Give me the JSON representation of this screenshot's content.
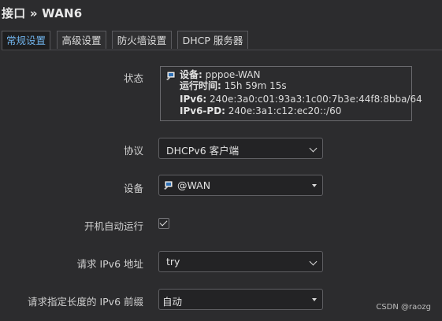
{
  "page": {
    "title": "接口 » WAN6"
  },
  "tabs": [
    {
      "label": "常规设置",
      "active": true
    },
    {
      "label": "高级设置",
      "active": false
    },
    {
      "label": "防火墙设置",
      "active": false
    },
    {
      "label": "DHCP 服务器",
      "active": false
    }
  ],
  "status": {
    "label": "状态",
    "device_key": "设备:",
    "device_val": " pppoe-WAN",
    "uptime_key": "运行时间:",
    "uptime_val": " 15h 59m 15s",
    "ipv6_key": "IPv6:",
    "ipv6_val": " 240e:3a0:c01:93a3:1c00:7b3e:44f8:8bba/64",
    "ipv6pd_key": "IPv6-PD:",
    "ipv6pd_val": " 240e:3a1:c12:ec20::/60"
  },
  "protocol": {
    "label": "协议",
    "value": "DHCPv6 客户端"
  },
  "device": {
    "label": "设备",
    "value": "@WAN"
  },
  "autostart": {
    "label": "开机自动运行",
    "checked": true
  },
  "req_addr": {
    "label": "请求 IPv6 地址",
    "value": "try"
  },
  "req_prefix": {
    "label": "请求指定长度的 IPv6 前缀",
    "value": "自动"
  },
  "watermark": "CSDN @raozg",
  "colors": {
    "active_tab": "#6fb1e8",
    "background": "#2c2c2e"
  }
}
